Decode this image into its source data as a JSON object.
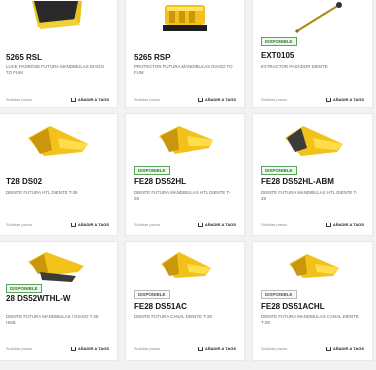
{
  "products": [
    {
      "badge": "",
      "sku": "5265 RSL",
      "description": "LUCE PADROSE FUTURA MANDIBULAS DIAGO TO FUM",
      "foot_left": "Solicitar precio",
      "foot_right": "AÑADIR A TAGS",
      "icon": "bucket-blade-icon"
    },
    {
      "badge": "",
      "sku": "5265 RSP",
      "description": "PROTECTOR FUTURA MANDIBULAS DIAGO TO FUM",
      "foot_left": "Solicitar precio",
      "foot_right": "AÑADIR A TAGS",
      "icon": "bucket-shroud-icon"
    },
    {
      "badge": "DISPONIBLE",
      "sku": "EXT0105",
      "description": "EXTRACTOR PASADOR DIENTE",
      "foot_left": "Solicitar precio",
      "foot_right": "AÑADIR A TAGS",
      "icon": "pin-extractor-icon"
    },
    {
      "badge": "",
      "sku": "T28 DS02",
      "description": "DIENTE FUTURA HTL DIENTE T-28",
      "foot_left": "Solicitar precio",
      "foot_right": "AÑADIR A TAGS",
      "icon": "bucket-tooth-icon"
    },
    {
      "badge": "DISPONIBLE",
      "sku": "FE28 DS52HL",
      "description": "DIENTE FUTURA MANDIBULAS HTL DIENTE T-28",
      "foot_left": "Solicitar precio",
      "foot_right": "AÑADIR A TAGS",
      "icon": "bucket-tooth-icon"
    },
    {
      "badge": "DISPONIBLE",
      "sku": "FE28 DS52HL-ABM",
      "description": "DIENTE FUTURA MANDIBULAS HTL DIENTE T-28",
      "foot_left": "Solicitar precio",
      "foot_right": "AÑADIR A TAGS",
      "icon": "bucket-tooth-dark-icon"
    },
    {
      "badge": "DISPONIBLE",
      "sku": "28 DS52WTHL-W",
      "description": "DIENTE FUTURA MANDIBULAS / DIAGO T-28 HIML",
      "foot_left": "Solicitar precio",
      "foot_right": "AÑADIR A TAGS",
      "icon": "bucket-tooth-twin-icon"
    },
    {
      "badge": "DISPONIBLE",
      "sku": "FE28 DS51AC",
      "description": "DIENTE FUTURA CANAL DIENTE T-28",
      "foot_left": "Solicitar precio",
      "foot_right": "AÑADIR A TAGS",
      "icon": "bucket-tooth-icon"
    },
    {
      "badge": "DISPONIBLE",
      "sku": "FE28 DS51ACHL",
      "description": "DIENTE FUTURA MANDIBULAS CANAL DIENTE T-28",
      "foot_left": "Solicitar precio",
      "foot_right": "AÑADIR A TAGS",
      "icon": "bucket-tooth-icon"
    }
  ],
  "colors": {
    "product_yellow": "#f2c21a",
    "product_shadow": "#c9960c",
    "badge_available": "#2f7d2f"
  }
}
